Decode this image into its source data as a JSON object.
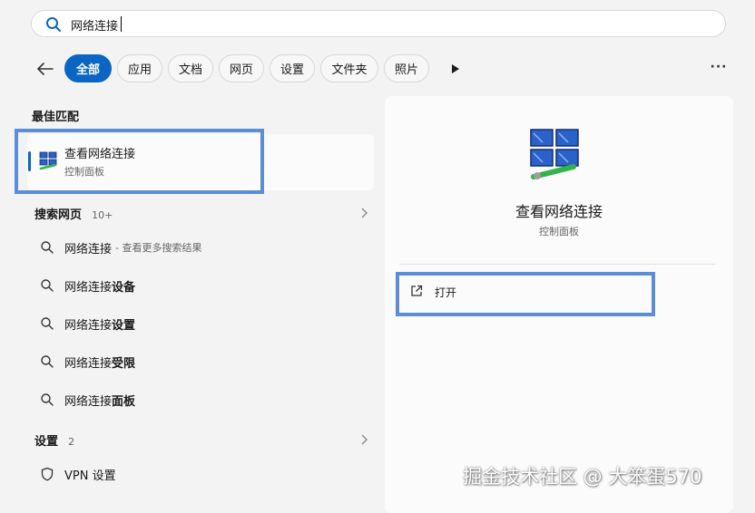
{
  "search": {
    "query": "网络连接",
    "placeholder": ""
  },
  "filters": {
    "back": "back",
    "chips": [
      "全部",
      "应用",
      "文档",
      "网页",
      "设置",
      "文件夹",
      "照片"
    ],
    "active_index": 0
  },
  "best_match": {
    "heading": "最佳匹配",
    "title": "查看网络连接",
    "subtitle": "控制面板",
    "icon": "network-connections-icon"
  },
  "web_search": {
    "heading": "搜索网页",
    "count": "10+",
    "items": [
      {
        "query": "网络连接",
        "suffix_bold": "",
        "note": "- 查看更多搜索结果"
      },
      {
        "query": "网络连接",
        "suffix_bold": "设备",
        "note": ""
      },
      {
        "query": "网络连接",
        "suffix_bold": "设置",
        "note": ""
      },
      {
        "query": "网络连接",
        "suffix_bold": "受限",
        "note": ""
      },
      {
        "query": "网络连接",
        "suffix_bold": "面板",
        "note": ""
      }
    ]
  },
  "settings_section": {
    "heading": "设置",
    "count": "2",
    "items": [
      {
        "label": "VPN 设置",
        "icon": "shield-icon"
      }
    ]
  },
  "detail": {
    "title": "查看网络连接",
    "subtitle": "控制面板",
    "actions": [
      {
        "label": "打开",
        "icon": "open-external-icon"
      }
    ]
  },
  "watermark": "掘金技术社区 @ 大笨蛋570",
  "colors": {
    "accent": "#0a66c2",
    "highlight": "#5b8ed6",
    "background": "#f3f3f3"
  }
}
